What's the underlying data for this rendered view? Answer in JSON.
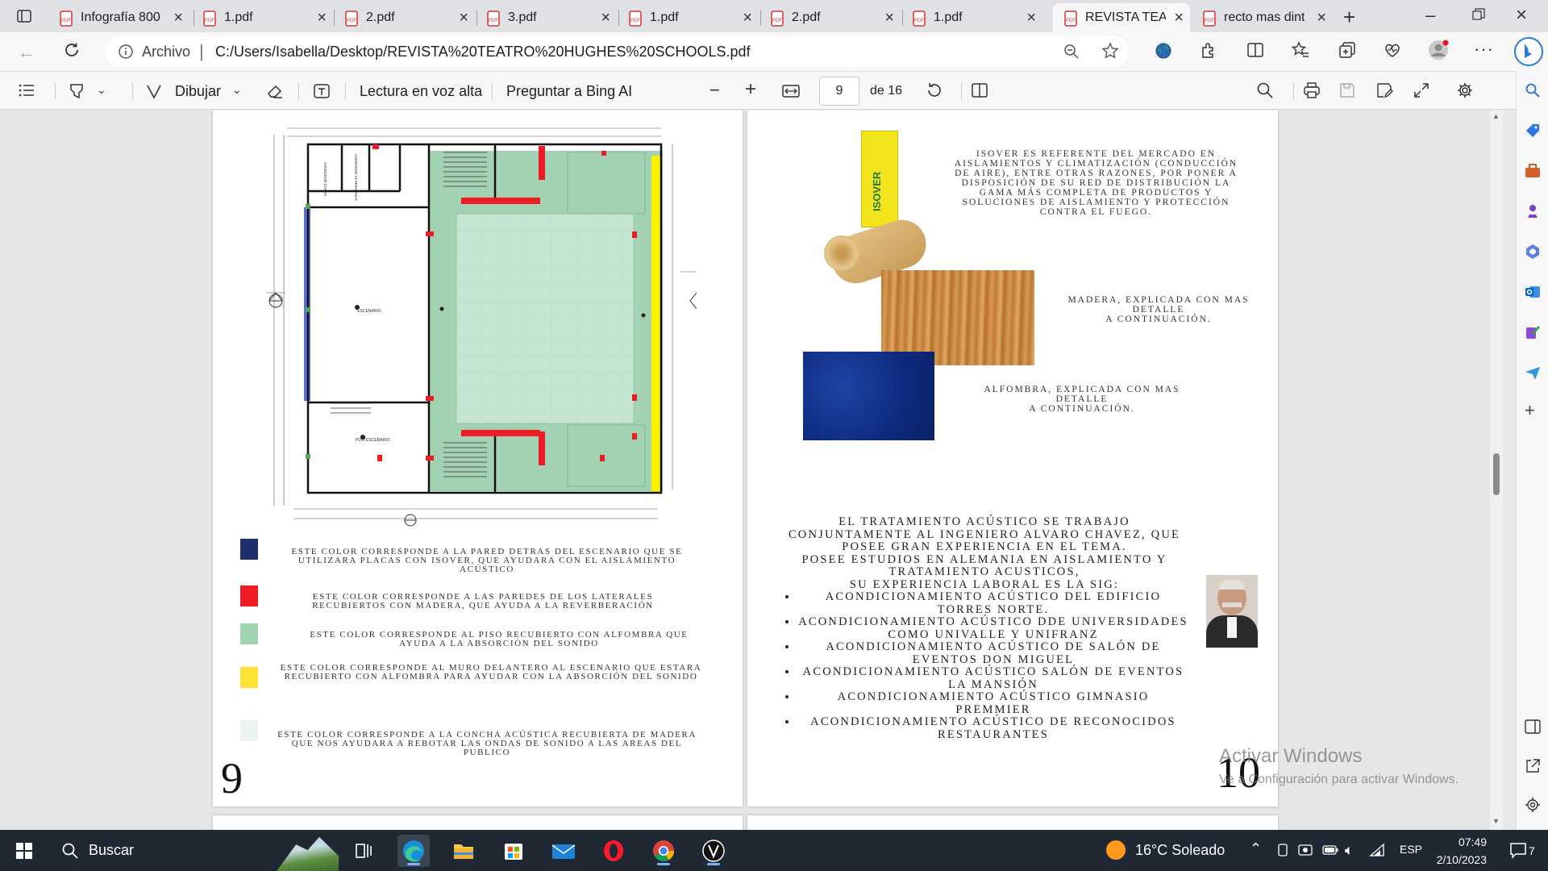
{
  "browser": {
    "tabs": [
      {
        "label": "Infografía 800"
      },
      {
        "label": "1.pdf"
      },
      {
        "label": "2.pdf"
      },
      {
        "label": "3.pdf"
      },
      {
        "label": "1.pdf"
      },
      {
        "label": "2.pdf"
      },
      {
        "label": "1.pdf"
      },
      {
        "label": "REVISTA TEATR",
        "active": true
      },
      {
        "label": "recto mas dint"
      }
    ],
    "address": {
      "prefix": "Archivo",
      "url": "C:/Users/Isabella/Desktop/REVISTA%20TEATRO%20HUGHES%20SCHOOLS.pdf"
    }
  },
  "pdf_toolbar": {
    "draw_label": "Dibujar",
    "read_aloud_label": "Lectura en voz alta",
    "ask_bing_label": "Preguntar a Bing AI",
    "page_current": "9",
    "page_total": "de 16"
  },
  "page_left": {
    "page_number": "9",
    "legend": [
      {
        "color": "#1e2f6b",
        "text": "ESTE COLOR CORRESPONDE A LA PARED DETRAS DEL ESCENARIO QUE SE UTILIZARA PLACAS CON ISOVER, QUE AYUDARA CON EL AISLAMIENTO ACÚSTICO"
      },
      {
        "color": "#ee1c24",
        "text": "ESTE COLOR CORRESPONDE A LAS PAREDES DE LOS LATERALES RECUBIERTOS CON MADERA, QUE AYUDA A LA REVERBERACIÓN"
      },
      {
        "color": "#9fd3b0",
        "text": "ESTE COLOR CORRESPONDE AL PISO RECUBIERTO CON ALFOMBRA QUE AYUDA A LA ABSORCIÓN DEL SONIDO"
      },
      {
        "color": "#ffe335",
        "text": "ESTE COLOR CORRESPONDE AL MURO DELANTERO AL ESCENARIO QUE ESTARA RECUBIERTO CON ALFOMBRA PARA AYUDAR CON LA ABSORCIÓN DEL SONIDO"
      },
      {
        "color": "#e9f4ef",
        "text": "ESTE COLOR CORRESPONDE A LA CONCHA ACÚSTICA RECUBIERTA DE MADERA QUE NOS AYUDARA A REBOTAR LAS ONDAS DE SONIDO A LAS AREAS DEL PUBLICO"
      }
    ],
    "plan_labels": {
      "elevator1": "ASCENSOR CARGA",
      "elevator2": "ASCENSOR 14 PERSONAS",
      "stage": "ESCENARIO",
      "backstage": "POSTESCENARIO"
    }
  },
  "page_right": {
    "page_number": "10",
    "isover_text": "ISOVER ES REFERENTE DEL MERCADO EN AISLAMIENTOS Y CLIMATIZACIÓN (CONDUCCIÓN DE AIRE), ENTRE OTRAS RAZONES, POR PONER A DISPOSICIÓN DE SU RED DE DISTRIBUCIÓN LA GAMA MÁS COMPLETA DE PRODUCTOS Y SOLUCIONES DE AISLAMIENTO Y PROTECCIÓN CONTRA EL FUEGO.",
    "wood_text_1": "MADERA, EXPLICADA CON MAS DETALLE",
    "wood_text_2": "A CONTINUACIÓN.",
    "carpet_text_1": "ALFOMBRA, EXPLICADA CON MAS DETALLE",
    "carpet_text_2": "A CONTINUACIÓN.",
    "isover_brand": "ISOVER",
    "body_intro": [
      "EL TRATAMIENTO ACÚSTICO SE TRABAJO CONJUNTAMENTE AL INGENIERO ALVARO CHAVEZ,  QUE POSEE GRAN EXPERIENCIA EN EL TEMA.",
      "POSEE ESTUDIOS EN ALEMANIA EN AISLAMIENTO Y TRATAMIENTO ACUSTICOS,",
      "SU EXPERIENCIA LABORAL ES LA SIG:"
    ],
    "bullets": [
      "ACONDICIONAMIENTO ACÚSTICO DEL EDIFICIO TORRES NORTE.",
      "ACONDICIONAMIENTO ACÚSTICO DDE UNIVERSIDADES COMO UNIVALLE Y UNIFRANZ",
      "ACONDICIONAMIENTO ACÚSTICO DE SALÓN DE EVENTOS DON MIGUEL",
      "ACONDICIONAMIENTO ACÚSTICO SALÓN DE EVENTOS LA MANSIÓN",
      "ACONDICIONAMIENTO ACÚSTICO GIMNASIO PREMMIER",
      "ACONDICIONAMIENTO ACÚSTICO DE RECONOCIDOS RESTAURANTES"
    ]
  },
  "watermark": {
    "title": "Activar Windows",
    "subtitle": "Ve a Configuración para activar Windows."
  },
  "taskbar": {
    "search_label": "Buscar",
    "weather": "16°C  Soleado",
    "lang": "ESP",
    "time": "07:49",
    "date": "2/10/2023",
    "notif_count": "7"
  }
}
